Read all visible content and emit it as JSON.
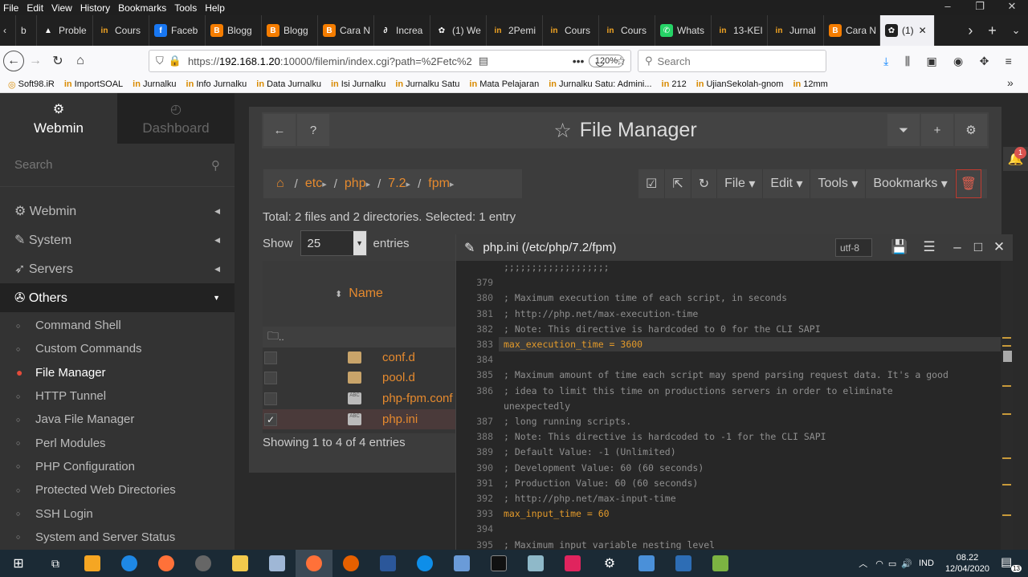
{
  "browser": {
    "menu": [
      "File",
      "Edit",
      "View",
      "History",
      "Bookmarks",
      "Tools",
      "Help"
    ],
    "tabs": [
      {
        "label": "b",
        "icon": "",
        "color": "#202020"
      },
      {
        "label": "Proble",
        "icon": "▲",
        "color": "#202020"
      },
      {
        "label": "Cours",
        "icon": "in",
        "color": "#202020"
      },
      {
        "label": "Faceb",
        "icon": "f",
        "color": "#1877f2"
      },
      {
        "label": "Blogg",
        "icon": "B",
        "color": "#f57d00"
      },
      {
        "label": "Blogg",
        "icon": "B",
        "color": "#f57d00"
      },
      {
        "label": "Cara N",
        "icon": "B",
        "color": "#f57d00"
      },
      {
        "label": "Increa",
        "icon": "∂",
        "color": "#202020"
      },
      {
        "label": "(1) We",
        "icon": "✿",
        "color": "#202020"
      },
      {
        "label": "2Pemi",
        "icon": "in",
        "color": "#202020"
      },
      {
        "label": "Cours",
        "icon": "in",
        "color": "#202020"
      },
      {
        "label": "Cours",
        "icon": "in",
        "color": "#202020"
      },
      {
        "label": "Whats",
        "icon": "✆",
        "color": "#25d366"
      },
      {
        "label": "13-KEI",
        "icon": "in",
        "color": "#202020"
      },
      {
        "label": "Jurnal",
        "icon": "in",
        "color": "#202020"
      },
      {
        "label": "Cara N",
        "icon": "B",
        "color": "#f57d00"
      },
      {
        "label": "(1)",
        "icon": "✿",
        "color": "#202020"
      }
    ],
    "url_prefix": "https://",
    "url_host": "192.168.1.20",
    "url_rest": ":10000/filemin/index.cgi?path=%2Fetc%2",
    "zoom": "120%",
    "search_placeholder": "Search",
    "bookmarks": [
      "Soft98.iR",
      "ImportSOAL",
      "Jurnalku",
      "Info Jurnalku",
      "Data Jurnalku",
      "Isi Jurnalku",
      "Jurnalku Satu",
      "Mata Pelajaran",
      "Jurnalku Satu: Admini...",
      "212",
      "UjianSekolah-gnom",
      "12mm"
    ]
  },
  "sidebar": {
    "tab_webmin": "Webmin",
    "tab_dashboard": "Dashboard",
    "search_placeholder": "Search",
    "categories": [
      "Webmin",
      "System",
      "Servers",
      "Others"
    ],
    "others_items": [
      "Command Shell",
      "Custom Commands",
      "File Manager",
      "HTTP Tunnel",
      "Java File Manager",
      "Perl Modules",
      "PHP Configuration",
      "Protected Web Directories",
      "SSH Login",
      "System and Server Status"
    ]
  },
  "filemanager": {
    "title": "File Manager",
    "path": [
      "etc",
      "php",
      "7.2",
      "fpm"
    ],
    "toolbar": [
      "File",
      "Edit",
      "Tools",
      "Bookmarks"
    ],
    "total_text": "Total: 2 files and 2 directories. Selected: 1 entry",
    "show_label": "Show",
    "show_value": "25",
    "entries_label": "entries",
    "name_header": "Name",
    "parent": "..",
    "files": [
      {
        "name": "conf.d",
        "type": "folder",
        "checked": false
      },
      {
        "name": "pool.d",
        "type": "folder",
        "checked": false
      },
      {
        "name": "php-fpm.conf",
        "type": "doc",
        "checked": false
      },
      {
        "name": "php.ini",
        "type": "doc",
        "checked": true
      }
    ],
    "showing_text": "Showing 1 to 4 of 4 entries"
  },
  "editor": {
    "title": "php.ini (/etc/php/7.2/fpm)",
    "encoding": "utf-8",
    "lines": [
      {
        "n": "",
        "t": ";;;;;;;;;;;;;;;;;;;",
        "c": true
      },
      {
        "n": "379",
        "t": "",
        "c": false
      },
      {
        "n": "380",
        "t": "; Maximum execution time of each script, in seconds",
        "c": true
      },
      {
        "n": "381",
        "t": "; http://php.net/max-execution-time",
        "c": true
      },
      {
        "n": "382",
        "t": "; Note: This directive is hardcoded to 0 for the CLI SAPI",
        "c": true
      },
      {
        "n": "383",
        "t": "max_execution_time = 3600",
        "c": false,
        "hl": true
      },
      {
        "n": "384",
        "t": "",
        "c": false
      },
      {
        "n": "385",
        "t": "; Maximum amount of time each script may spend parsing request data. It's a good",
        "c": true
      },
      {
        "n": "386",
        "t": "; idea to limit this time on productions servers in order to eliminate",
        "c": true
      },
      {
        "n": "",
        "t": "unexpectedly",
        "c": true
      },
      {
        "n": "387",
        "t": "; long running scripts.",
        "c": true
      },
      {
        "n": "388",
        "t": "; Note: This directive is hardcoded to -1 for the CLI SAPI",
        "c": true
      },
      {
        "n": "389",
        "t": "; Default Value: -1 (Unlimited)",
        "c": true
      },
      {
        "n": "390",
        "t": "; Development Value: 60 (60 seconds)",
        "c": true
      },
      {
        "n": "391",
        "t": "; Production Value: 60 (60 seconds)",
        "c": true
      },
      {
        "n": "392",
        "t": "; http://php.net/max-input-time",
        "c": true
      },
      {
        "n": "393",
        "t": "max_input_time = 60",
        "c": false
      },
      {
        "n": "394",
        "t": "",
        "c": false
      },
      {
        "n": "395",
        "t": "; Maximum input variable nesting level",
        "c": true
      }
    ]
  },
  "notification_count": "1",
  "taskbar": {
    "language": "IND",
    "time": "08.22",
    "date": "12/04/2020",
    "notif_count": "13"
  }
}
